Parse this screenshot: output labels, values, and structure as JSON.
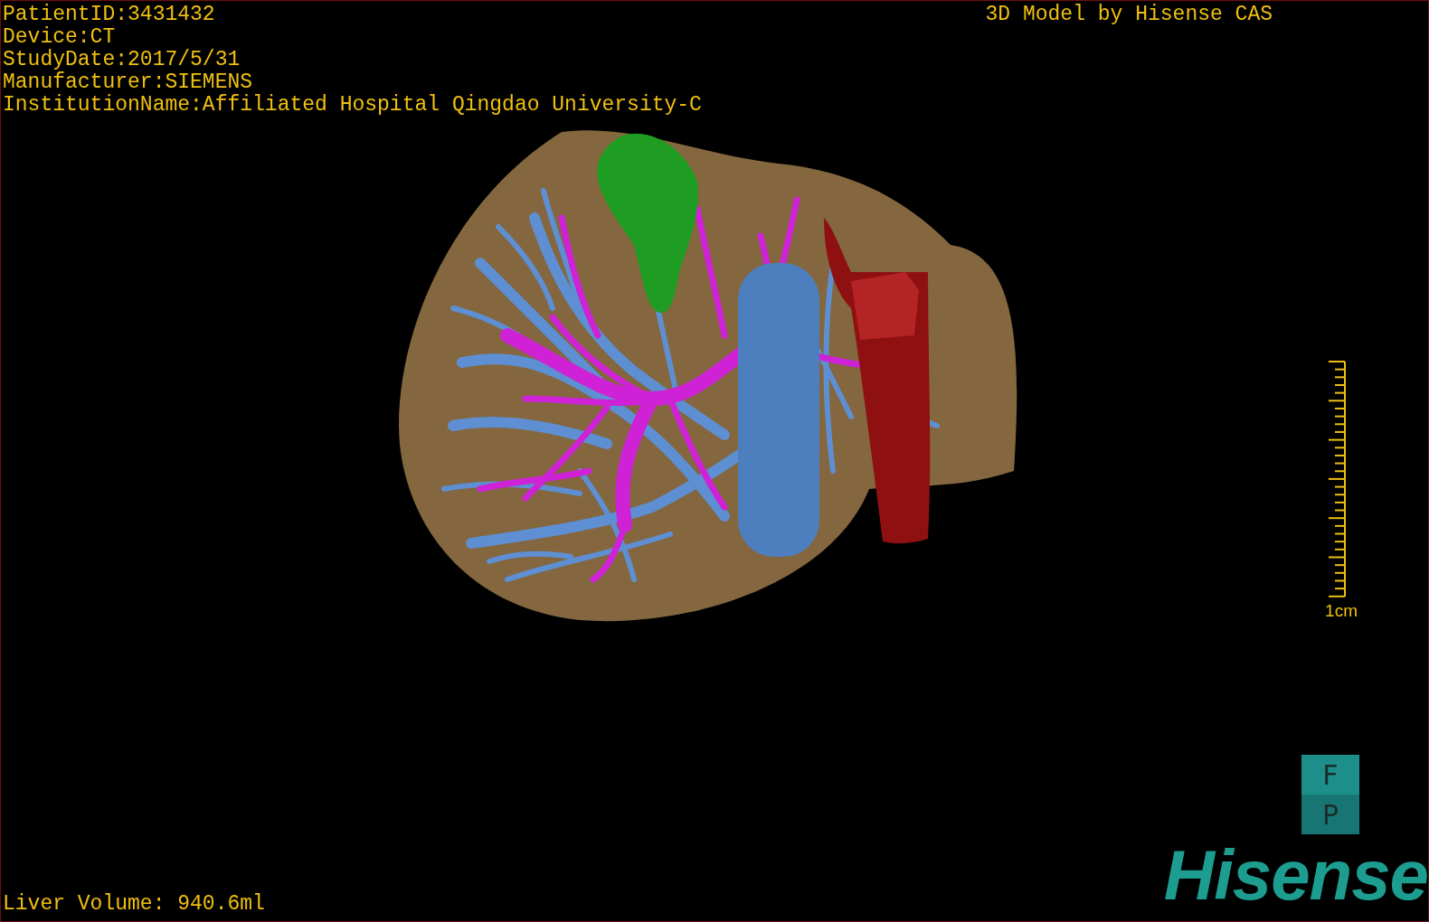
{
  "info_lines": [
    "PatientID:3431432",
    "Device:CT",
    "StudyDate:2017/5/31",
    "Manufacturer:SIEMENS",
    "InstitutionName:Affiliated Hospital Qingdao University-C"
  ],
  "title": "3D Model by Hisense CAS",
  "scale_bar": {
    "label": "1cm"
  },
  "liver_volume": "Liver Volume: 940.6ml",
  "orientation_marker": {
    "top": "F",
    "bottom": "P"
  },
  "logo": "Hisense"
}
